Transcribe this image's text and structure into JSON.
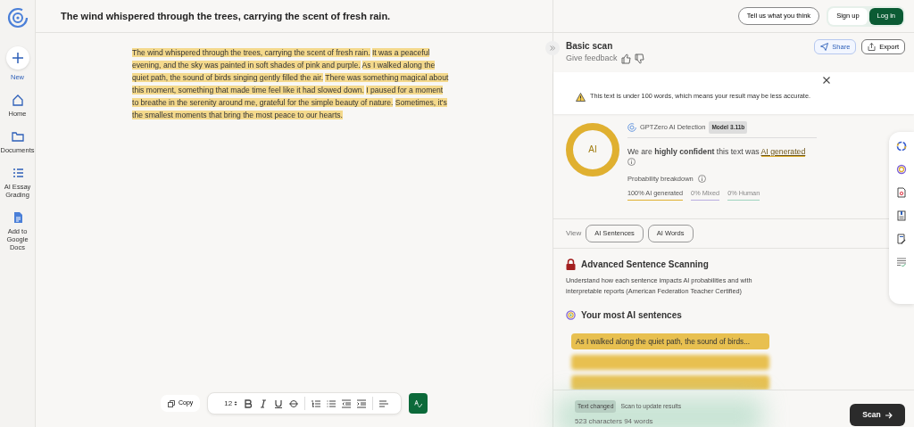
{
  "sidebar": {
    "items": [
      {
        "label": "New",
        "kind": "new"
      },
      {
        "label": "Home",
        "kind": "home"
      },
      {
        "label": "Documents",
        "kind": "folder"
      },
      {
        "label": "AI Essay Grading",
        "kind": "grading"
      },
      {
        "label": "Add to Google Docs",
        "kind": "doc"
      }
    ]
  },
  "document_title": "The wind whispered through the trees, carrying the scent of fresh rain.",
  "header_buttons": [
    {
      "label": "Tell us what you think",
      "kind": "outline"
    },
    {
      "label": "Sign up",
      "kind": "light"
    },
    {
      "label": "Log in",
      "kind": "primary"
    }
  ],
  "passage": {
    "sentences": [
      {
        "text": "The wind whispered through the trees, carrying the scent of fresh rain.",
        "highlighted": true
      },
      {
        "text": "It was a peaceful evening, and the sky was painted in soft shades of pink and purple.",
        "highlighted": true
      },
      {
        "text": "As I walked along the quiet path, the sound of birds singing gently filled the air.",
        "highlighted": true
      },
      {
        "text": "There was something magical about this moment, something that made time feel like it had slowed down.",
        "highlighted": true
      },
      {
        "text": "I paused for a moment to breathe in the serenity around me, grateful for the simple beauty of nature.",
        "highlighted": true
      },
      {
        "text": "Sometimes, it's the smallest moments that bring the most peace to our hearts.",
        "highlighted": true
      }
    ]
  },
  "toolbar": {
    "copy": "Copy",
    "font_size": "12"
  },
  "scan_panel": {
    "title": "Basic scan",
    "feedback": "Give feedback",
    "actions": [
      {
        "label": "Share",
        "kind": "share"
      },
      {
        "label": "Export",
        "kind": "export"
      }
    ],
    "notice": "This text is under 100 words, which means your result may be less accurate.",
    "result": {
      "ring_label": "AI",
      "level": 1.0,
      "detector": "GPTZero AI Detection",
      "model": "Model 3.11b",
      "verdict": "We are **highly confident** this text was",
      "verdict_link": "AI generated",
      "breakdown_label": "Probability breakdown",
      "breakdown": [
        {
          "label": "100% AI generated",
          "color": "#e0b030",
          "selected": true
        },
        {
          "label": "0% Mixed",
          "color": "#b9aee0",
          "selected": false
        },
        {
          "label": "0% Human",
          "color": "#9fd4bf",
          "selected": false
        }
      ]
    },
    "view_label": "View",
    "views": [
      {
        "label": "AI Sentences"
      },
      {
        "label": "AI Words"
      }
    ],
    "advanced": {
      "title": "Advanced Sentence Scanning",
      "description": "Understand how each sentence impacts AI probabilities and with interpretable reports (American Federation Teacher Certified)"
    },
    "top_sentences": {
      "title": "Your most AI sentences",
      "first": "As I walked along the quiet path, the sound of birds..."
    },
    "footer": {
      "badge": "Text changed",
      "hint": "Scan to update results",
      "counts": "523 characters 94 words",
      "scan_button": "Scan"
    }
  }
}
